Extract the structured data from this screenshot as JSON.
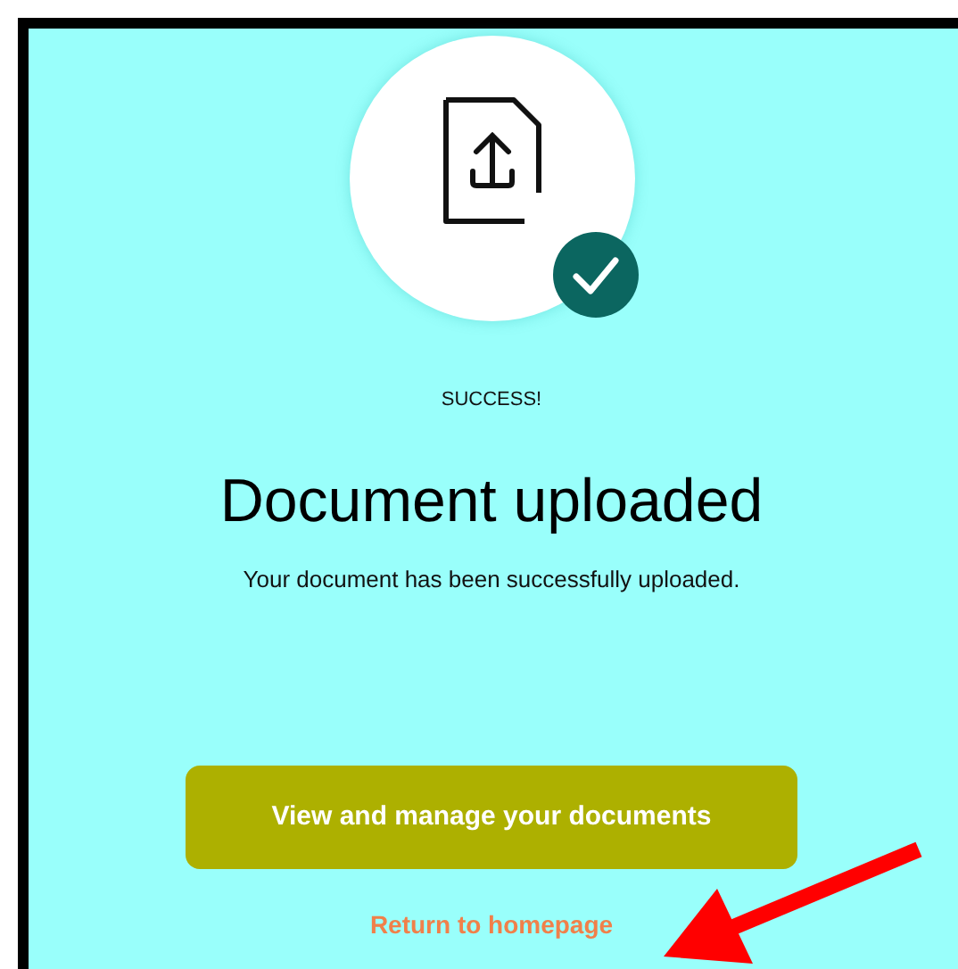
{
  "status_label": "SUCCESS!",
  "heading": "Document uploaded",
  "message": "Your document has been successfully uploaded.",
  "primary_button": {
    "label": "View and manage your documents"
  },
  "link": {
    "label": "Return to homepage"
  }
}
